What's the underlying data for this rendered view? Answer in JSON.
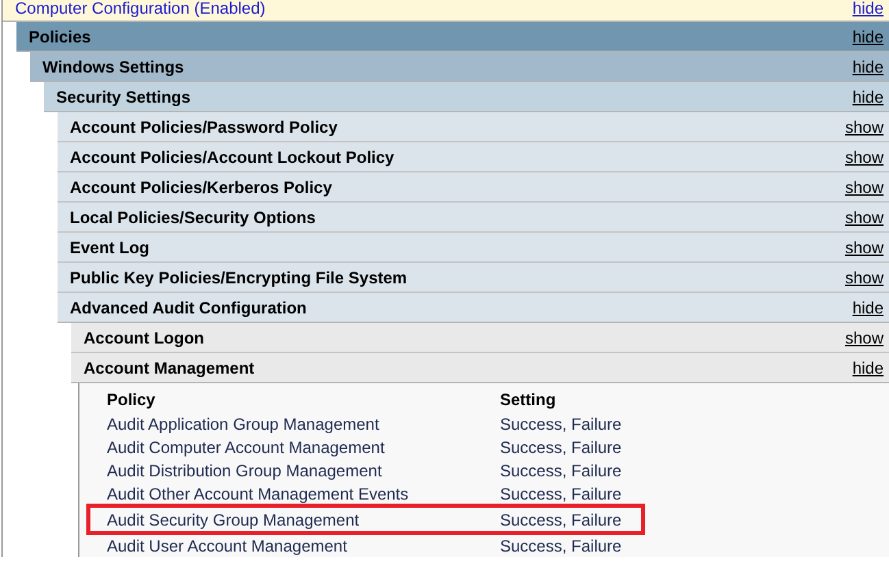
{
  "tree": {
    "title": "Computer Configuration (Enabled)",
    "toggle": "hide",
    "expanded": true,
    "children": [
      {
        "title": "Policies",
        "toggle": "hide",
        "expanded": true,
        "children": [
          {
            "title": "Windows Settings",
            "toggle": "hide",
            "expanded": true,
            "children": [
              {
                "title": "Security Settings",
                "toggle": "hide",
                "expanded": true,
                "children": [
                  {
                    "title": "Account Policies/Password Policy",
                    "toggle": "show",
                    "expanded": false
                  },
                  {
                    "title": "Account Policies/Account Lockout Policy",
                    "toggle": "show",
                    "expanded": false
                  },
                  {
                    "title": "Account Policies/Kerberos Policy",
                    "toggle": "show",
                    "expanded": false
                  },
                  {
                    "title": "Local Policies/Security Options",
                    "toggle": "show",
                    "expanded": false
                  },
                  {
                    "title": "Event Log",
                    "toggle": "show",
                    "expanded": false
                  },
                  {
                    "title": "Public Key Policies/Encrypting File System",
                    "toggle": "show",
                    "expanded": false
                  },
                  {
                    "title": "Advanced Audit Configuration",
                    "toggle": "hide",
                    "expanded": true,
                    "children": [
                      {
                        "title": "Account Logon",
                        "toggle": "show",
                        "expanded": false
                      },
                      {
                        "title": "Account Management",
                        "toggle": "hide",
                        "expanded": true,
                        "table": {
                          "columns": [
                            "Policy",
                            "Setting"
                          ],
                          "rows": [
                            {
                              "cells": [
                                "Audit Application Group Management",
                                "Success, Failure"
                              ],
                              "highlighted": false
                            },
                            {
                              "cells": [
                                "Audit Computer Account Management",
                                "Success, Failure"
                              ],
                              "highlighted": false
                            },
                            {
                              "cells": [
                                "Audit Distribution Group Management",
                                "Success, Failure"
                              ],
                              "highlighted": false
                            },
                            {
                              "cells": [
                                "Audit Other Account Management Events",
                                "Success, Failure"
                              ],
                              "highlighted": false
                            },
                            {
                              "cells": [
                                "Audit Security Group Management",
                                "Success, Failure"
                              ],
                              "highlighted": true
                            },
                            {
                              "cells": [
                                "Audit User Account Management",
                                "Success, Failure"
                              ],
                              "highlighted": false
                            }
                          ]
                        }
                      }
                    ]
                  }
                ]
              }
            ]
          }
        ]
      }
    ]
  }
}
